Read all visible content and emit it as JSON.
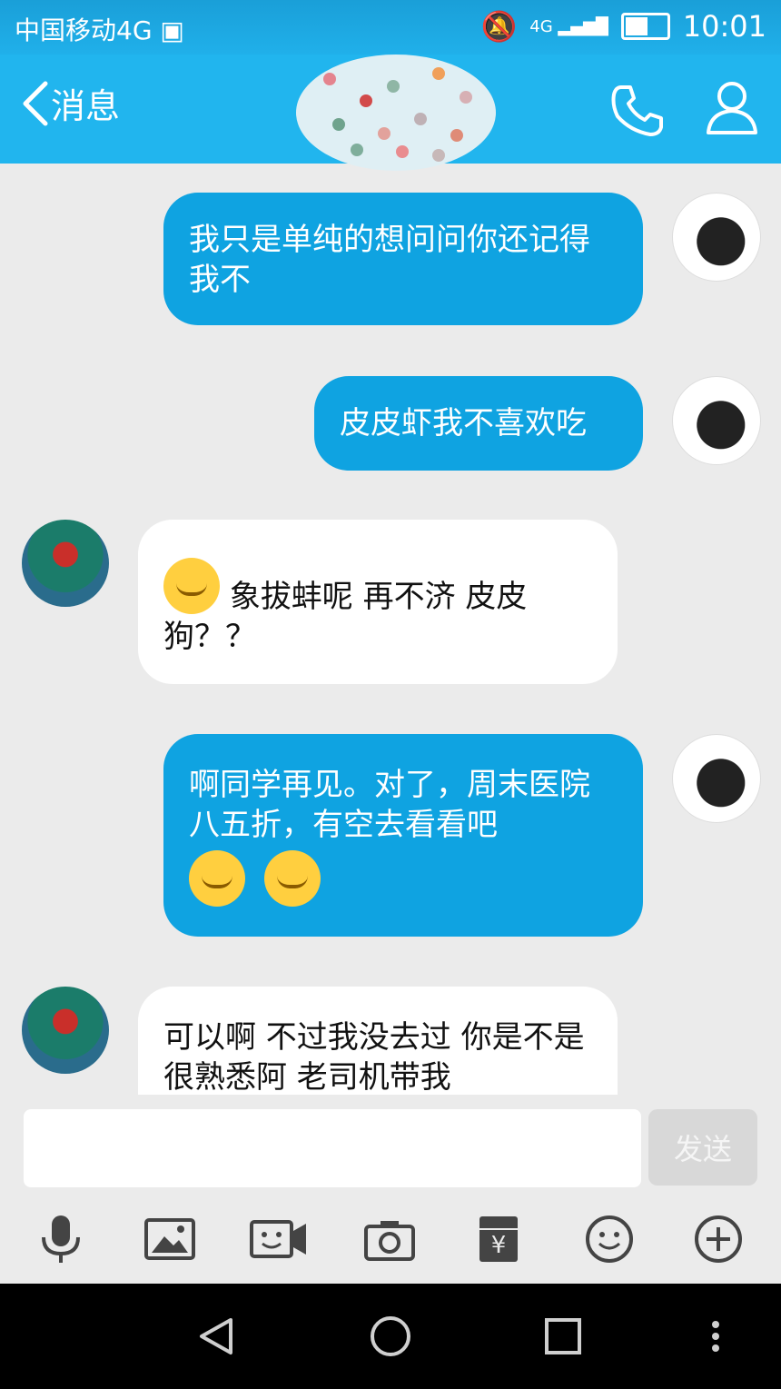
{
  "status": {
    "carrier": "中国移动4G",
    "time": "10:01",
    "signal_label": "4G"
  },
  "header": {
    "back_label": "消息"
  },
  "messages": [
    {
      "side": "me",
      "text": "我只是单纯的想问问你还记得我不"
    },
    {
      "side": "me",
      "text": "皮皮虾我不喜欢吃"
    },
    {
      "side": "them",
      "text": "象拔蚌呢 再不济 皮皮狗？？"
    },
    {
      "side": "me",
      "text": "啊同学再见。对了，周末医院八五折，有空去看看吧"
    },
    {
      "side": "them",
      "text": "可以啊 不过我没去过 你是不是很熟悉阿 老司机带我"
    }
  ],
  "composer": {
    "placeholder": "",
    "send_label": "发送"
  },
  "icons": {
    "toolbar": [
      "microphone-icon",
      "image-icon",
      "video-icon",
      "camera-icon",
      "red-packet-icon",
      "emoji-icon",
      "plus-icon"
    ]
  }
}
